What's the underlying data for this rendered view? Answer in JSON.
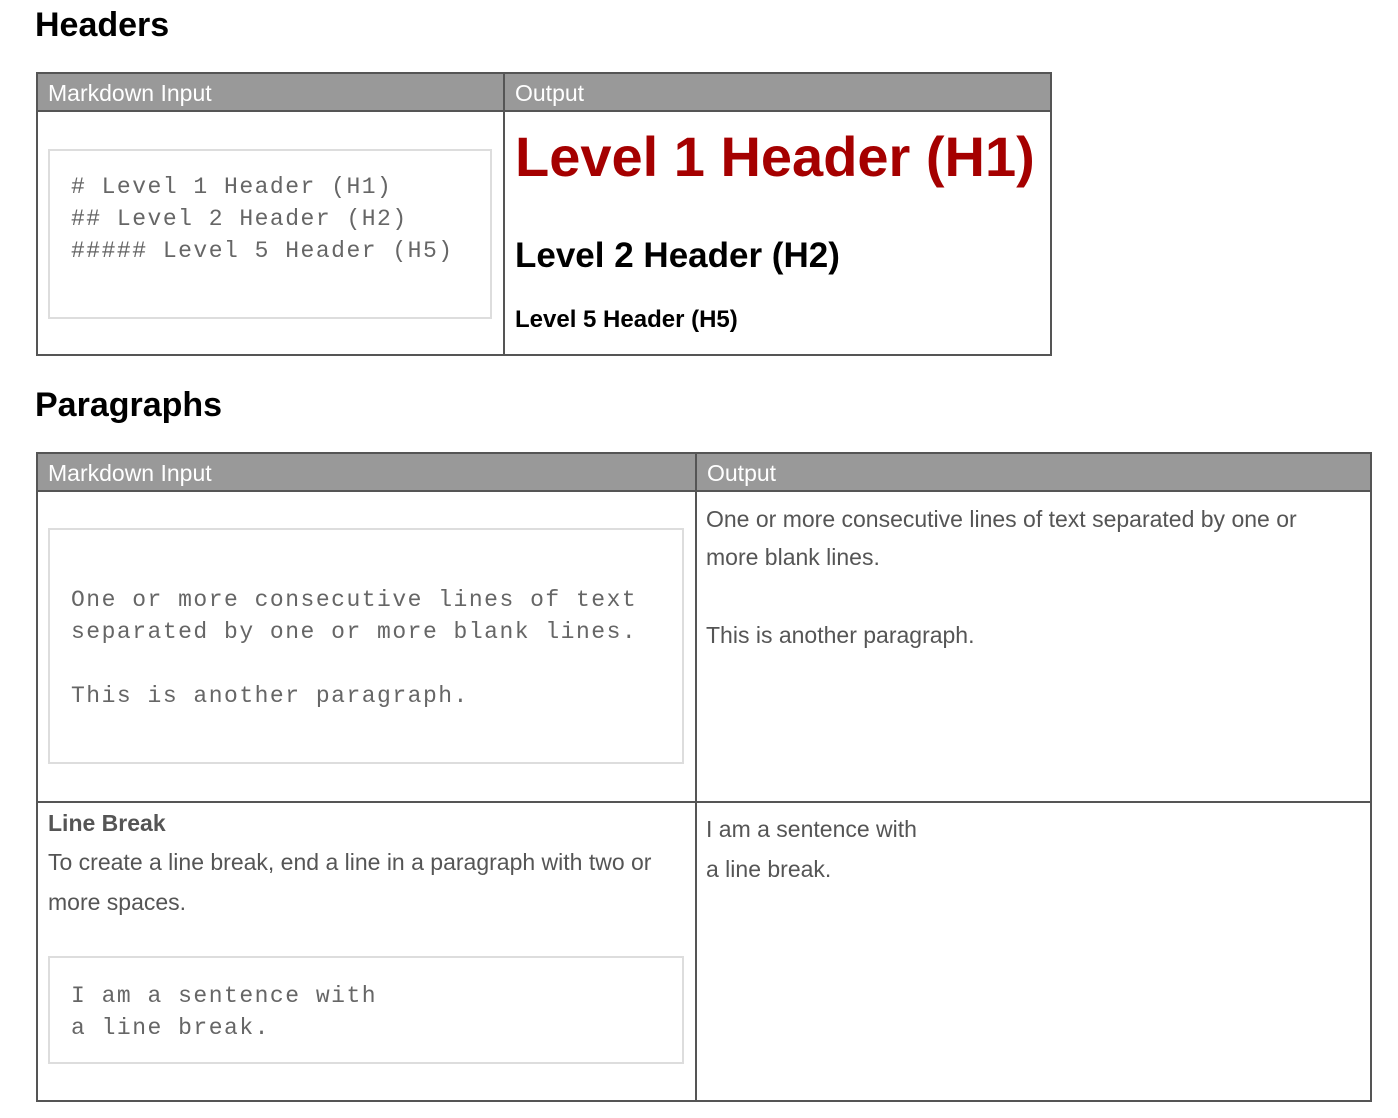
{
  "headers_section": {
    "title": "Headers",
    "col_input": "Markdown Input",
    "col_output": "Output",
    "code_lines": [
      "# Level 1 Header (H1)",
      "## Level 2 Header (H2)",
      "##### Level 5 Header (H5)"
    ],
    "h1": "Level 1 Header (H1)",
    "h2": "Level 2 Header (H2)",
    "h5": "Level 5 Header (H5)"
  },
  "paragraphs_section": {
    "title": "Paragraphs",
    "col_input": "Markdown Input",
    "col_output": "Output",
    "code_lines": [
      "One or more consecutive lines of text",
      "separated by one or more blank lines.",
      "",
      "This is another paragraph."
    ],
    "output_p1": "One or more consecutive lines of text separated by one or more blank lines.",
    "output_p2": "This is another paragraph.",
    "line_break": {
      "title": "Line Break",
      "description": "To create a line break, end a line in a paragraph with two or more spaces.",
      "code_lines": [
        "I am a sentence with",
        "a line break."
      ],
      "output_lines": [
        "I am a sentence with",
        "a line break."
      ]
    }
  },
  "colors": {
    "h1": "#a50000",
    "header_bg": "#999999"
  }
}
